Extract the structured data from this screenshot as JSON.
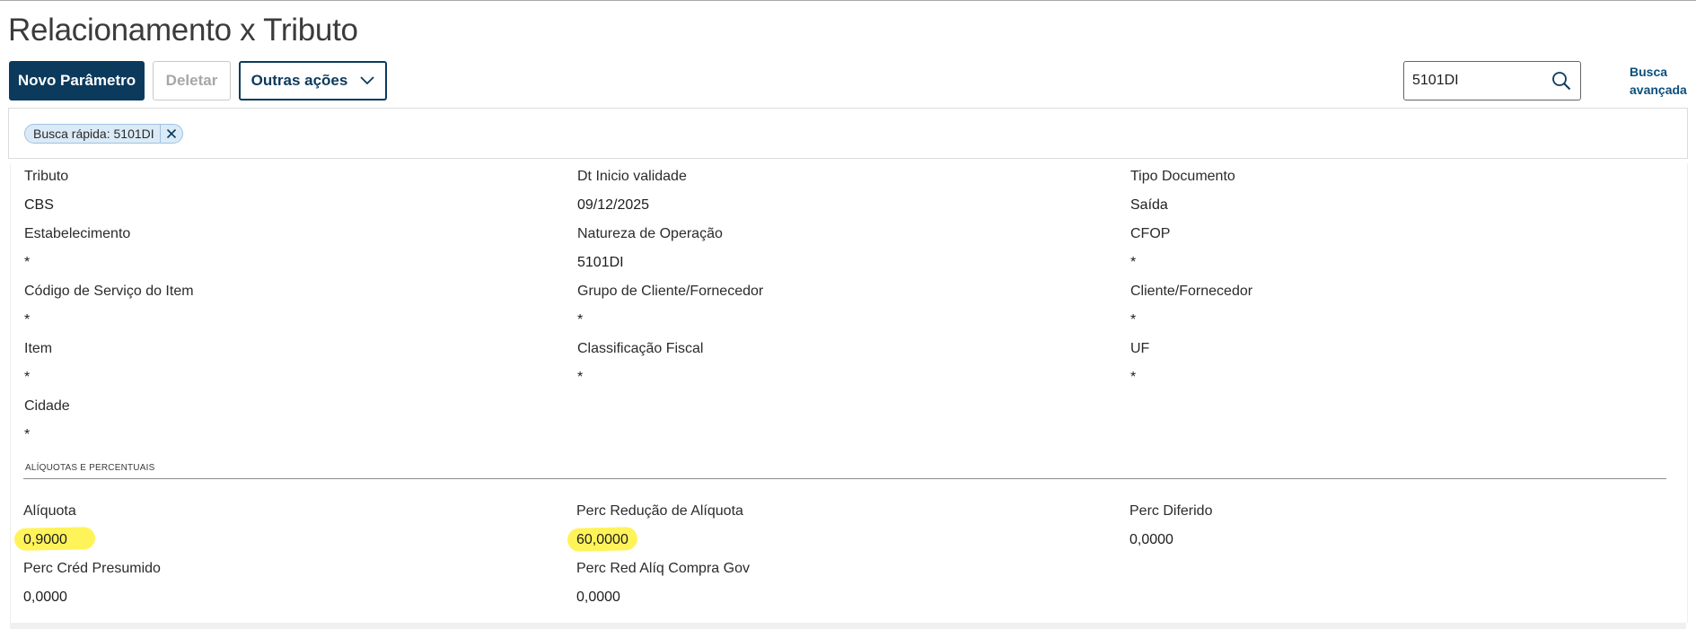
{
  "page": {
    "title": "Relacionamento x Tributo"
  },
  "toolbar": {
    "new_label": "Novo Parâmetro",
    "delete_label": "Deletar",
    "more_label": "Outras ações"
  },
  "search": {
    "value": "5101DI",
    "advanced_label": "Busca avançada"
  },
  "filters": {
    "chip_label": "Busca rápida: 5101DI"
  },
  "fields": {
    "tributo": {
      "label": "Tributo",
      "value": "CBS"
    },
    "dt_inicio": {
      "label": "Dt Inicio validade",
      "value": "09/12/2025"
    },
    "tipo_doc": {
      "label": "Tipo Documento",
      "value": "Saída"
    },
    "estabelecimento": {
      "label": "Estabelecimento",
      "value": "*"
    },
    "natureza": {
      "label": "Natureza de Operação",
      "value": "5101DI"
    },
    "cfop": {
      "label": "CFOP",
      "value": "*"
    },
    "cod_servico": {
      "label": "Código de Serviço do Item",
      "value": "*"
    },
    "grupo_cli": {
      "label": "Grupo de Cliente/Fornecedor",
      "value": "*"
    },
    "cli_forn": {
      "label": "Cliente/Fornecedor",
      "value": "*"
    },
    "item": {
      "label": "Item",
      "value": "*"
    },
    "class_fiscal": {
      "label": "Classificação Fiscal",
      "value": "*"
    },
    "uf": {
      "label": "UF",
      "value": "*"
    },
    "cidade": {
      "label": "Cidade",
      "value": "*"
    }
  },
  "section": {
    "title": "ALÍQUOTAS E PERCENTUAIS"
  },
  "rates": {
    "aliquota": {
      "label": "Alíquota",
      "value": "0,9000"
    },
    "perc_reducao": {
      "label": "Perc Redução de Alíquota",
      "value": "60,0000"
    },
    "perc_diferido": {
      "label": "Perc Diferido",
      "value": "0,0000"
    },
    "perc_cred": {
      "label": "Perc Créd Presumido",
      "value": "0,0000"
    },
    "perc_red_gov": {
      "label": "Perc Red Alíq Compra Gov",
      "value": "0,0000"
    }
  },
  "colors": {
    "primary": "#0b3a5c",
    "link": "#0b4f7c",
    "chip_bg": "#dbeaf7",
    "highlight": "#fff35a"
  },
  "icons": {
    "search": "search-icon",
    "chevron": "chevron-down-icon",
    "close": "close-icon"
  }
}
